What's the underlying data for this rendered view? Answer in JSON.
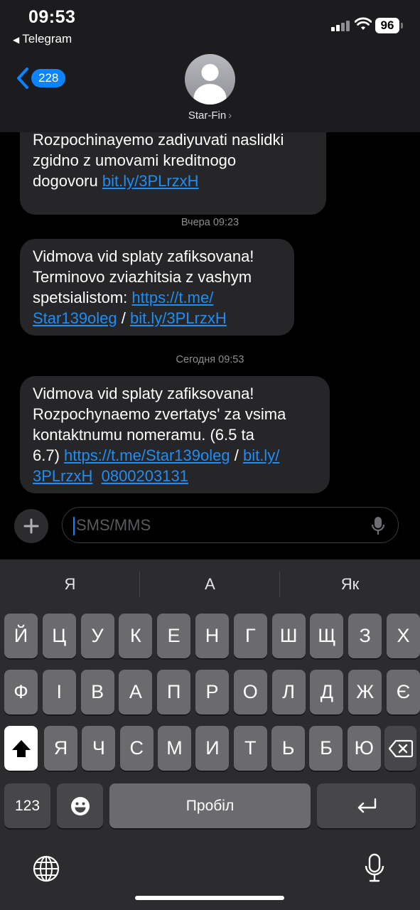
{
  "status": {
    "time": "09:53",
    "back_app": "Telegram",
    "battery": "96"
  },
  "header": {
    "unread_count": "228",
    "contact_name": "Star-Fin",
    "contact_arrow": "›"
  },
  "messages": [
    {
      "lines": [
        "Rozpochinayemo zadiyuvati naslidki",
        "zgidno z umovami kreditnogo"
      ],
      "line3_text": "dogovoru ",
      "line3_link": "bit.ly/3PLrzxH"
    },
    {
      "timestamp": "Вчера 09:23",
      "l1": "Vidmova vid splaty zafiksovana!",
      "l2": "Terminovo zviazhitsia z vashym",
      "l3_text": "spetsialistom: ",
      "l3_link": "https://t.me/",
      "l4_link1": "Star139oleg",
      "l4_sep": " / ",
      "l4_link2": "bit.ly/3PLrzxH"
    },
    {
      "timestamp": "Сегодня 09:53",
      "l1": "Vidmova vid splaty zafiksovana!",
      "l2": "Rozpochynaemo zvertatys' za vsima",
      "l3": "kontaktnumu nomeramu. (6.5 ta",
      "l4_text": "6.7) ",
      "l4_link1": "https://t.me/Star139oleg",
      "l4_sep": " / ",
      "l4_link2": "bit.ly/",
      "l5_link1": "3PLrzxH",
      "l5_gap": "  ",
      "l5_link2": "0800203131"
    }
  ],
  "composer": {
    "placeholder": "SMS/MMS"
  },
  "keyboard": {
    "suggestions": [
      "Я",
      "А",
      "Як"
    ],
    "row1": [
      "Й",
      "Ц",
      "У",
      "К",
      "Е",
      "Н",
      "Г",
      "Ш",
      "Щ",
      "З",
      "Х"
    ],
    "row2": [
      "Ф",
      "І",
      "В",
      "А",
      "П",
      "Р",
      "О",
      "Л",
      "Д",
      "Ж",
      "Є"
    ],
    "row3": [
      "Я",
      "Ч",
      "С",
      "М",
      "И",
      "Т",
      "Ь",
      "Б",
      "Ю"
    ],
    "numbers_key": "123",
    "space_key": "Пробіл"
  },
  "icons": [
    "back-chevron-icon",
    "contact-avatar-icon",
    "plus-icon",
    "microphone-icon",
    "shift-icon",
    "backspace-icon",
    "emoji-icon",
    "return-icon",
    "globe-icon",
    "dictation-icon",
    "signal-icon",
    "wifi-icon"
  ]
}
